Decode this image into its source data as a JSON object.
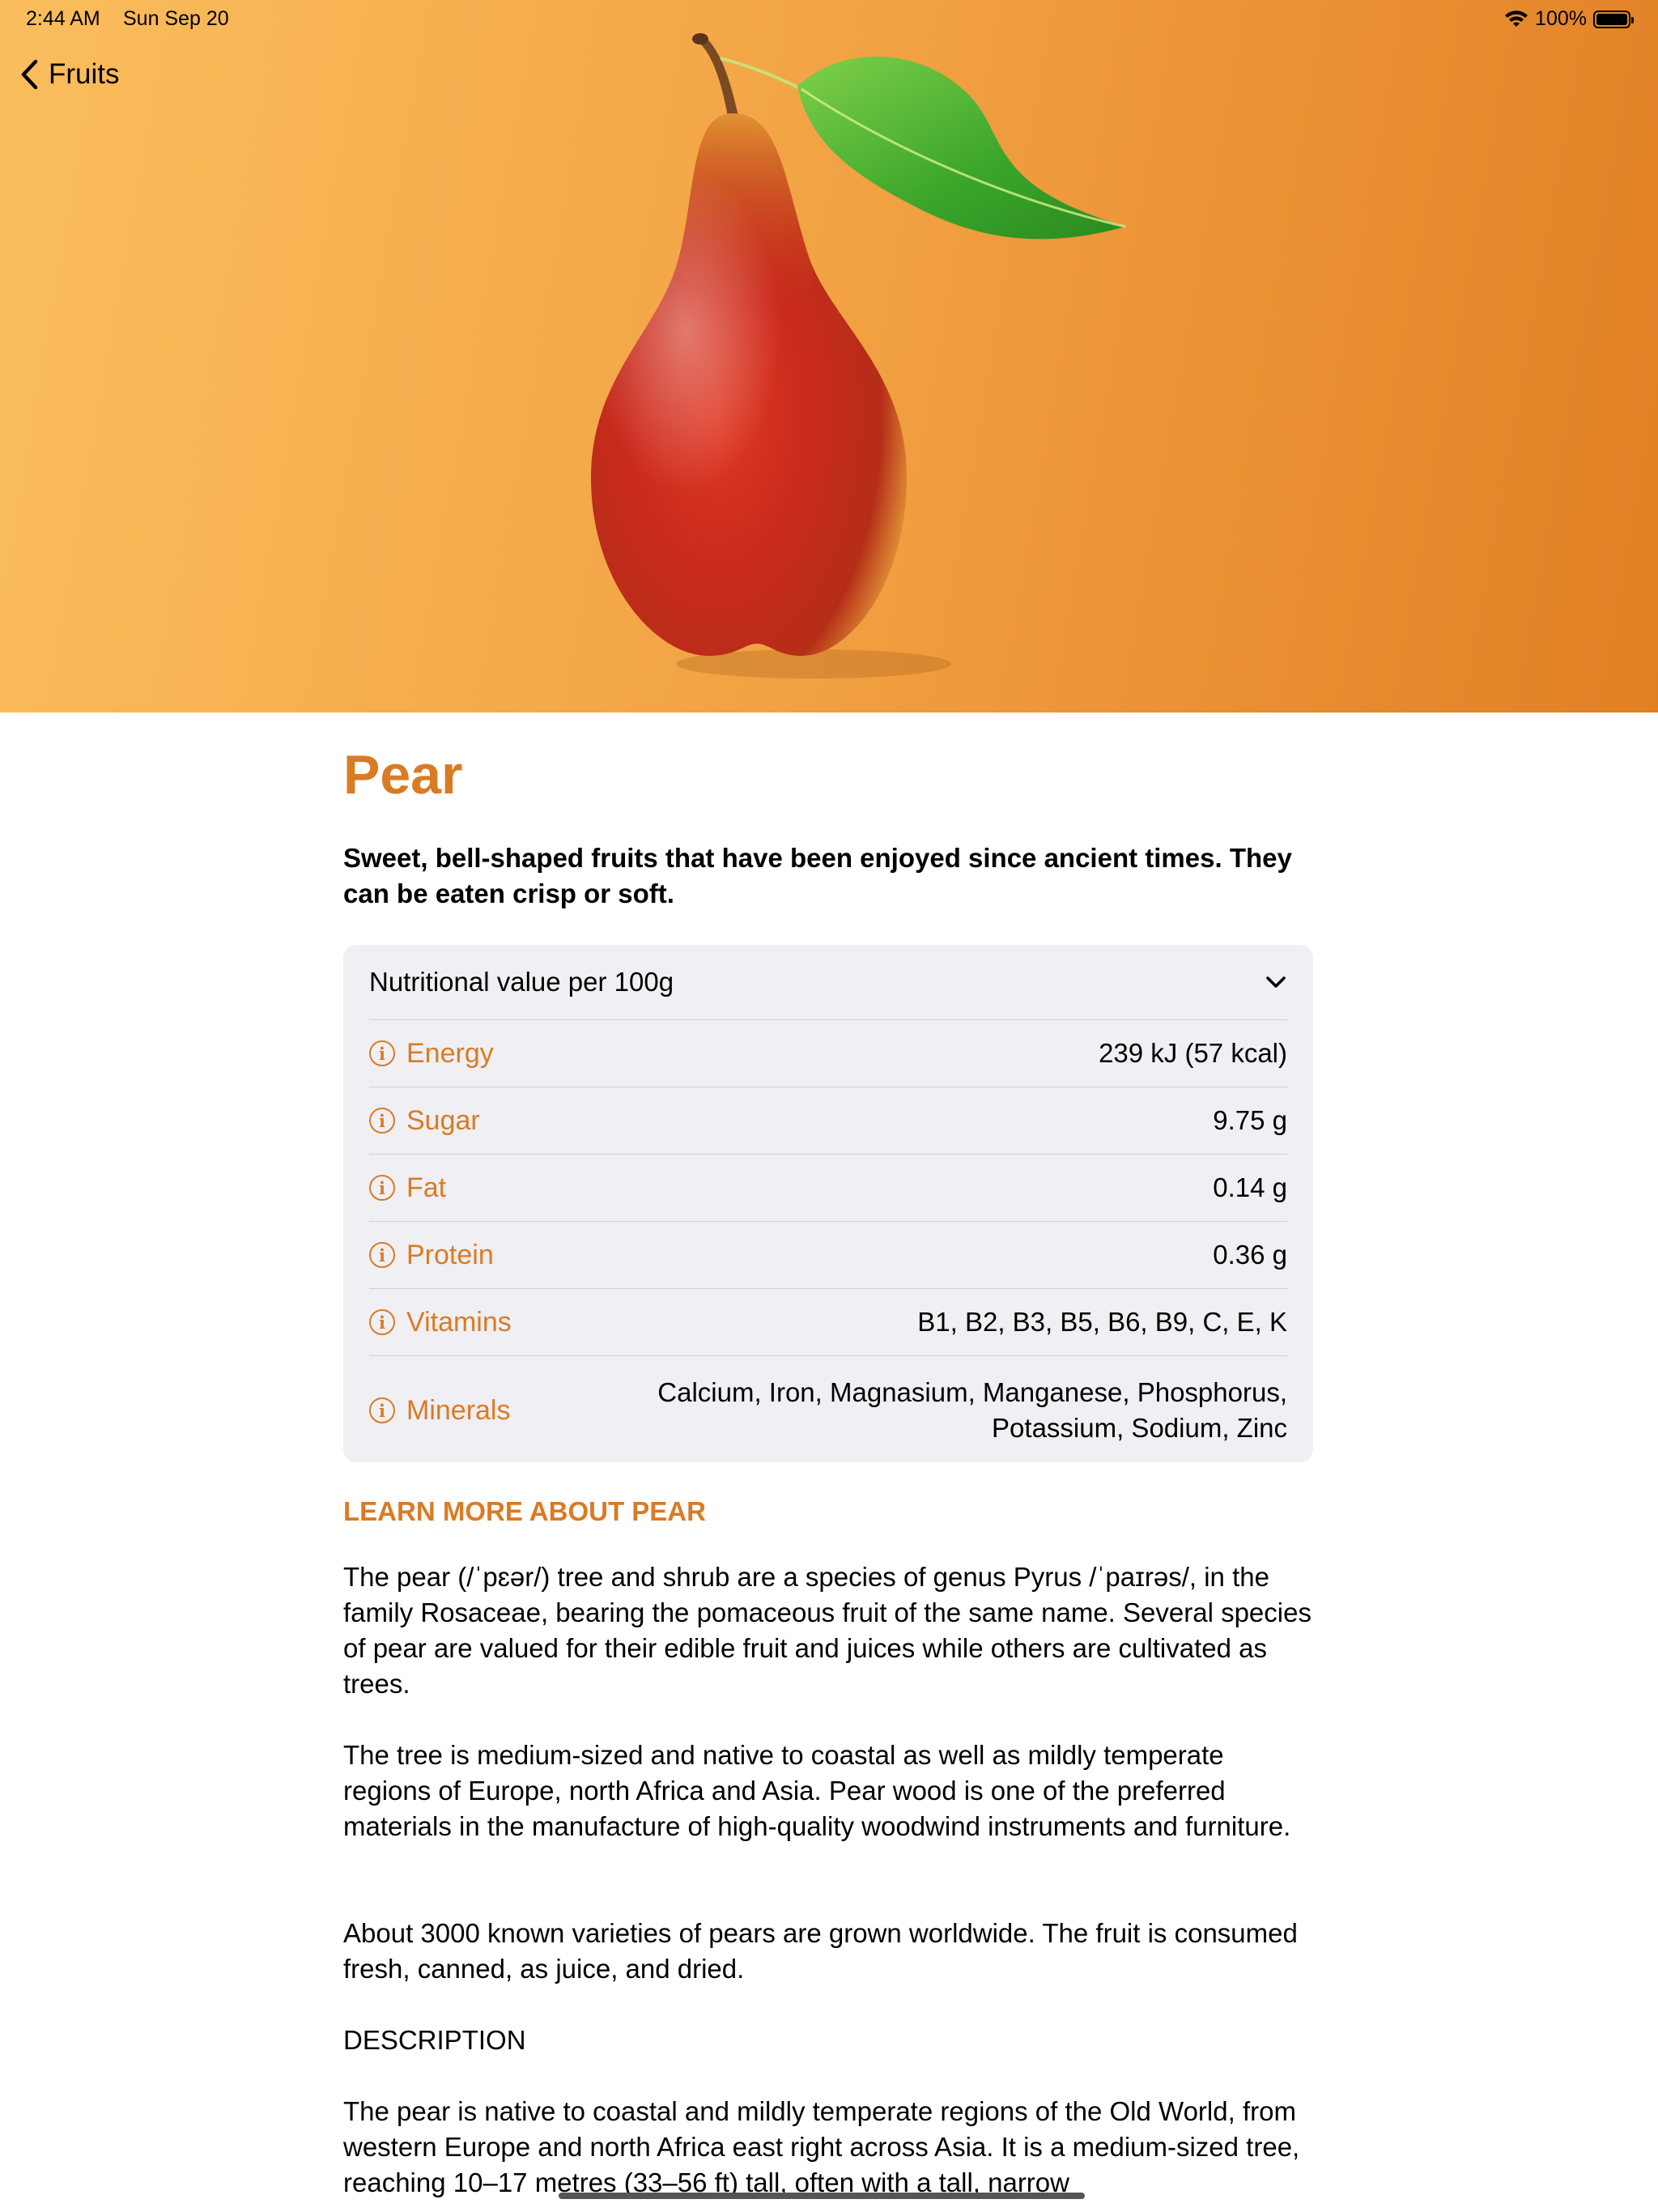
{
  "status_bar": {
    "time": "2:44 AM",
    "date": "Sun Sep 20",
    "battery": "100%"
  },
  "nav": {
    "back_label": "Fruits"
  },
  "colors": {
    "accent": "#d97b24",
    "hero_start": "#fbbe5d",
    "hero_end": "#e27f25",
    "card_bg": "#efeff4"
  },
  "fruit": {
    "name": "Pear",
    "tagline": "Sweet, bell-shaped fruits that have been enjoyed since ancient times. They can be eaten crisp or soft."
  },
  "nutrition": {
    "header": "Nutritional value per 100g",
    "rows": [
      {
        "label": "Energy",
        "value": "239 kJ (57 kcal)"
      },
      {
        "label": "Sugar",
        "value": "9.75 g"
      },
      {
        "label": "Fat",
        "value": "0.14 g"
      },
      {
        "label": "Protein",
        "value": "0.36 g"
      },
      {
        "label": "Vitamins",
        "value": "B1, B2, B3, B5, B6, B9, C, E, K"
      },
      {
        "label": "Minerals",
        "value": "Calcium, Iron, Magnasium, Manganese, Phosphorus, Potassium, Sodium, Zinc"
      }
    ]
  },
  "learn_more": {
    "heading": "LEARN MORE ABOUT PEAR",
    "paragraphs": [
      "The pear (/ˈpɛər/) tree and shrub are a species of genus Pyrus /ˈpaɪrəs/, in the family Rosaceae, bearing the pomaceous fruit of the same name. Several species of pear are valued for their edible fruit and juices while others are cultivated as trees.",
      "The tree is medium-sized and native to coastal as well as mildly temperate regions of Europe, north Africa and Asia. Pear wood is one of the preferred materials in the manufacture of high-quality woodwind instruments and furniture.",
      "About 3000 known varieties of pears are grown worldwide. The fruit is consumed fresh, canned, as juice, and dried.",
      "DESCRIPTION",
      "The pear is native to coastal and mildly temperate regions of the Old World, from western Europe and north Africa east right across Asia. It is a medium-sized tree, reaching 10–17 metres (33–56 ft) tall, often with a tall, narrow"
    ]
  }
}
